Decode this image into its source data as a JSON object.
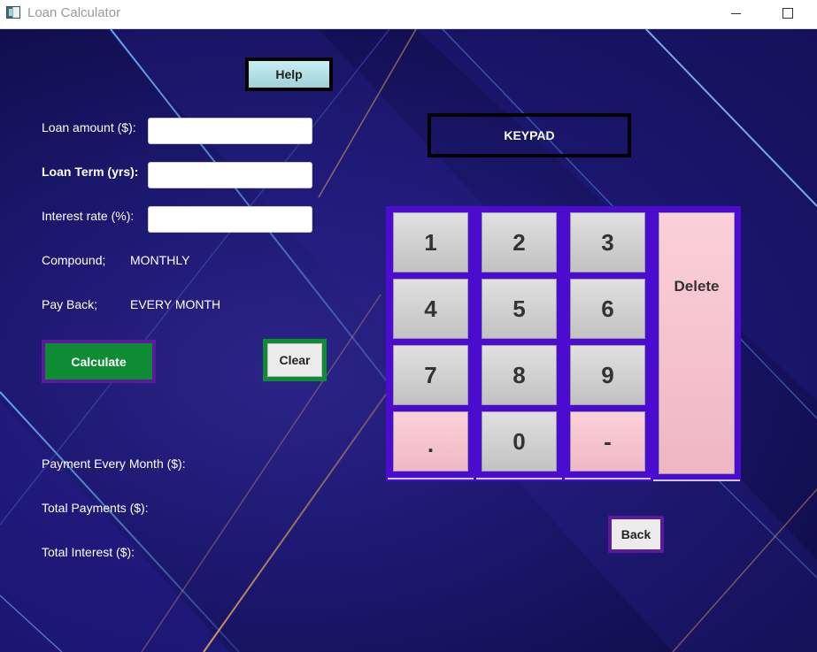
{
  "window": {
    "title": "Loan Calculator"
  },
  "header": {
    "help_label": "Help",
    "keypad_title": "KEYPAD"
  },
  "form": {
    "loan_amount_label": "Loan amount ($):",
    "loan_amount_value": "",
    "loan_term_label": "Loan Term (yrs):",
    "loan_term_value": "",
    "interest_rate_label": "Interest rate (%):",
    "interest_rate_value": "",
    "compound_label": "Compound;",
    "compound_value": "MONTHLY",
    "payback_label": "Pay Back;",
    "payback_value": "EVERY MONTH"
  },
  "actions": {
    "calculate_label": "Calculate",
    "clear_label": "Clear",
    "back_label": "Back"
  },
  "results": {
    "payment_label": "Payment Every Month ($):",
    "payment_value": "",
    "total_payments_label": "Total Payments ($):",
    "total_payments_value": "",
    "total_interest_label": "Total Interest ($):",
    "total_interest_value": ""
  },
  "keypad": {
    "keys": [
      "1",
      "2",
      "3",
      "4",
      "5",
      "6",
      "7",
      "8",
      "9",
      ".",
      "0",
      "-"
    ],
    "delete_label": "Delete"
  },
  "colors": {
    "background": "#1c1870",
    "keypad_frame": "#4b0ccf",
    "calculate_button": "#0d8c34",
    "accent_border": "#5b1a9e",
    "special_key": "#f7c4d0"
  }
}
